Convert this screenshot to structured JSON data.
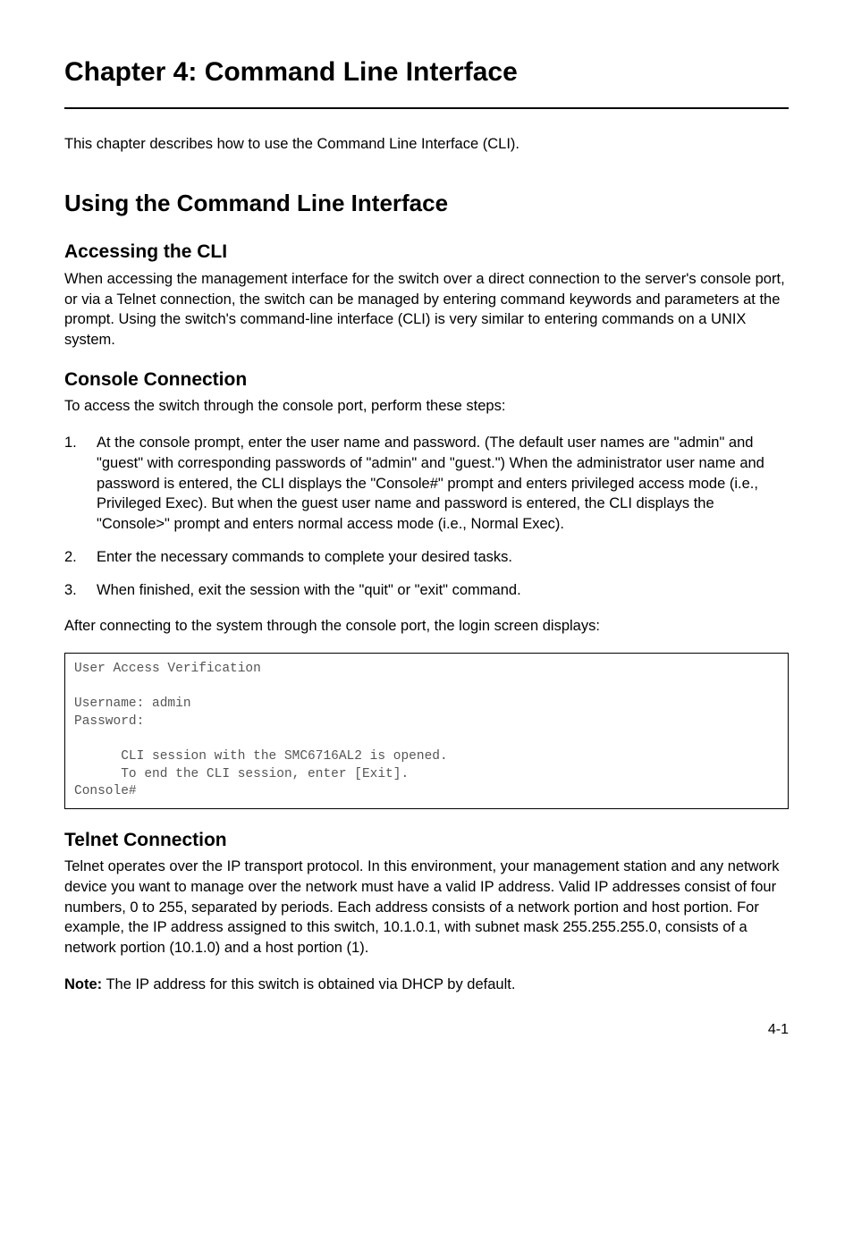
{
  "chapter": {
    "title": "Chapter 4: Command Line Interface",
    "intro": "This chapter describes how to use the Command Line Interface (CLI)."
  },
  "section1": {
    "heading": "Using the Command Line Interface"
  },
  "accessing": {
    "heading": "Accessing the CLI",
    "body": "When accessing the management interface for the switch over a direct connection to the server's console port, or via a Telnet connection, the switch can be managed by entering command keywords and parameters at the prompt. Using the switch's command-line interface (CLI) is very similar to entering commands on a UNIX system."
  },
  "console": {
    "heading": "Console Connection",
    "intro": "To access the switch through the console port, perform these steps:",
    "items": [
      {
        "num": "1.",
        "text": "At the console prompt, enter the user name and password. (The default user names are \"admin\" and \"guest\" with corresponding passwords of \"admin\" and \"guest.\") When the administrator user name and password is entered, the CLI displays the \"Console#\" prompt and enters privileged access mode (i.e., Privileged Exec). But when the guest user name and password is entered, the CLI displays the \"Console>\" prompt and enters normal access mode (i.e., Normal Exec)."
      },
      {
        "num": "2.",
        "text": "Enter the necessary commands to complete your desired tasks."
      },
      {
        "num": "3.",
        "text": "When finished, exit the session with the \"quit\" or \"exit\" command."
      }
    ],
    "after": "After connecting to the system through the console port, the login screen displays:",
    "code": "User Access Verification\n\nUsername: admin\nPassword:\n\n      CLI session with the SMC6716AL2 is opened.\n      To end the CLI session, enter [Exit].\nConsole#"
  },
  "telnet": {
    "heading": "Telnet Connection",
    "body": "Telnet operates over the IP transport protocol. In this environment, your management station and any network device you want to manage over the network must have a valid IP address. Valid IP addresses consist of four numbers, 0 to 255, separated by periods. Each address consists of a network portion and host portion. For example, the IP address assigned to this switch, 10.1.0.1, with subnet mask 255.255.255.0, consists of a network portion (10.1.0) and a host portion (1).",
    "note_label": "Note:",
    "note_text": "  The IP address for this switch is obtained via DHCP by default."
  },
  "page": {
    "number": "4-1"
  }
}
